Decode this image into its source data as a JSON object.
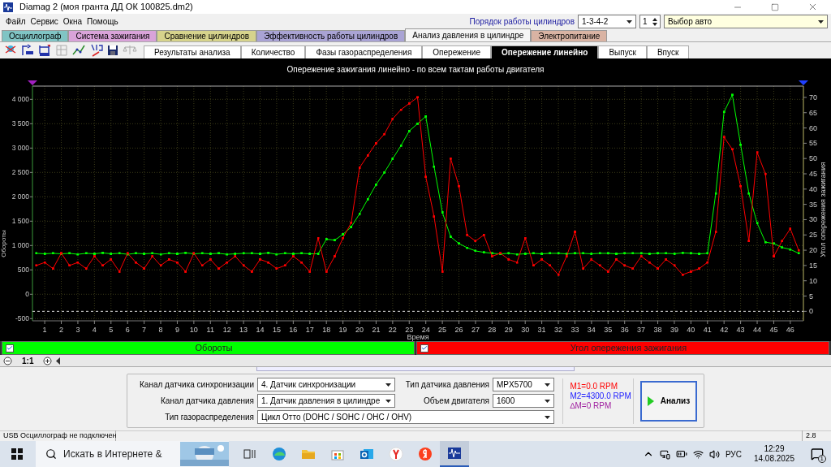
{
  "window": {
    "title": "Diamag 2 (моя гранта ДД ОК 100825.dm2)"
  },
  "menu": [
    "Файл",
    "Сервис",
    "Окна",
    "Помощь"
  ],
  "cylinder_order": {
    "label": "Порядок работы цилиндров",
    "value": "1-3-4-2"
  },
  "cylinder_spinner": {
    "value": "1"
  },
  "car_select": {
    "value": "Выбор авто"
  },
  "main_tabs": [
    {
      "label": "Осциллограф",
      "color": "#80c4c4",
      "selected": false
    },
    {
      "label": "Система зажигания",
      "color": "#d9a3d9",
      "selected": false
    },
    {
      "label": "Сравнение цилиндров",
      "color": "#d6d38c",
      "selected": false
    },
    {
      "label": "Эффективность работы цилиндров",
      "color": "#a9a3d4",
      "selected": false
    },
    {
      "label": "Анализ давления в цилиндре",
      "color": "#f5f5f5",
      "selected": true
    },
    {
      "label": "Электропитание",
      "color": "#d9b3a3",
      "selected": false
    }
  ],
  "sub_tabs": [
    {
      "label": "Результаты анализа",
      "selected": false
    },
    {
      "label": "Количество",
      "selected": false
    },
    {
      "label": "Фазы газораспределения",
      "selected": false
    },
    {
      "label": "Опережение",
      "selected": false
    },
    {
      "label": "Опережение линейно",
      "selected": true
    },
    {
      "label": "Выпуск",
      "selected": false
    },
    {
      "label": "Впуск",
      "selected": false
    }
  ],
  "chart": {
    "chart_data": {
      "type": "line",
      "title": "Опережение зажигания линейно - по всем тактам работы двигателя",
      "xlabel": "Время",
      "ylabel": "Обороты",
      "y2label": "Угол опережения зажигания",
      "x": [
        0.5,
        1,
        1.5,
        2,
        2.5,
        3,
        3.5,
        4,
        4.5,
        5,
        5.5,
        6,
        6.5,
        7,
        7.5,
        8,
        8.5,
        9,
        9.5,
        10,
        10.5,
        11,
        11.5,
        12,
        12.5,
        13,
        13.5,
        14,
        14.5,
        15,
        15.5,
        16,
        16.5,
        17,
        17.5,
        18,
        18.5,
        19,
        19.5,
        20,
        20.5,
        21,
        21.5,
        22,
        22.5,
        23,
        23.5,
        24,
        24.5,
        25,
        25.5,
        26,
        26.5,
        27,
        27.5,
        28,
        28.5,
        29,
        29.5,
        30,
        30.5,
        31,
        31.5,
        32,
        32.5,
        33,
        33.5,
        34,
        34.5,
        35,
        35.5,
        36,
        36.5,
        37,
        37.5,
        38,
        38.5,
        39,
        39.5,
        40,
        40.5,
        41,
        41.5,
        42,
        42.5,
        43,
        43.5,
        44,
        44.5,
        45,
        45.5,
        46,
        46.5
      ],
      "series": [
        {
          "name": "Обороты",
          "color": "#00ff00",
          "values": [
            840,
            830,
            840,
            830,
            840,
            820,
            840,
            830,
            850,
            830,
            840,
            820,
            840,
            830,
            840,
            820,
            840,
            830,
            850,
            830,
            840,
            830,
            840,
            820,
            830,
            840,
            840,
            830,
            850,
            820,
            840,
            830,
            840,
            830,
            830,
            1130,
            1110,
            1230,
            1380,
            1650,
            1950,
            2250,
            2500,
            2780,
            3050,
            3350,
            3500,
            3650,
            2620,
            1680,
            1180,
            1040,
            955,
            890,
            860,
            840,
            830,
            840,
            820,
            830,
            840,
            830,
            840,
            840,
            830,
            840,
            840,
            830,
            840,
            840,
            830,
            840,
            840,
            840,
            830,
            840,
            840,
            830,
            850,
            840,
            830,
            840,
            2070,
            3740,
            4090,
            3070,
            2070,
            1460,
            1070,
            1040,
            960,
            920,
            840
          ]
        },
        {
          "name": "Угол опережения зажигания",
          "color": "#ff0000",
          "axis": "y2",
          "values": [
            15,
            16,
            14,
            19,
            15,
            16,
            14,
            18,
            15,
            17,
            13,
            19,
            16,
            14,
            18,
            15,
            17,
            16,
            13,
            19,
            15,
            17,
            14,
            16,
            18,
            15,
            13,
            17,
            16,
            14,
            15,
            18,
            16,
            13,
            24,
            13,
            18,
            24,
            29,
            47,
            51,
            55,
            58,
            63,
            66,
            68,
            70,
            44,
            31,
            13,
            50,
            41,
            25,
            23,
            25,
            18,
            19,
            17,
            16,
            24,
            15,
            17,
            15,
            12,
            18,
            26,
            14,
            17,
            15,
            13,
            17,
            15,
            14,
            18,
            16,
            14,
            17,
            15,
            12,
            13,
            14,
            16,
            26,
            57,
            53,
            41,
            23,
            52,
            45,
            18,
            23,
            27,
            20
          ]
        }
      ],
      "grid": true,
      "ref_lines": [
        {
          "axis": "y2",
          "value": 0
        }
      ],
      "xlim": [
        0.26,
        46.79
      ],
      "ylim": [
        -545,
        4272
      ],
      "y2lim": [
        -3.1,
        73.7
      ],
      "xticks": [
        1,
        2,
        3,
        4,
        5,
        6,
        7,
        8,
        9,
        10,
        11,
        12,
        13,
        14,
        15,
        16,
        17,
        18,
        19,
        20,
        21,
        22,
        23,
        24,
        25,
        26,
        27,
        28,
        29,
        30,
        31,
        32,
        33,
        34,
        35,
        36,
        37,
        38,
        39,
        40,
        41,
        42,
        43,
        44,
        45,
        46
      ],
      "yticks": [
        {
          "value": -500,
          "label": "-500"
        },
        {
          "value": 0,
          "label": "0"
        },
        {
          "value": 500,
          "label": "500"
        },
        {
          "value": 1000,
          "label": "1 000"
        },
        {
          "value": 1500,
          "label": "1 500"
        },
        {
          "value": 2000,
          "label": "2 000"
        },
        {
          "value": 2500,
          "label": "2 500"
        },
        {
          "value": 3000,
          "label": "3 000"
        },
        {
          "value": 3500,
          "label": "3 500"
        },
        {
          "value": 4000,
          "label": "4 000"
        }
      ],
      "y2ticks": [
        0,
        5,
        10,
        15,
        20,
        25,
        30,
        35,
        40,
        45,
        50,
        55,
        60,
        65,
        70
      ]
    }
  },
  "legend": [
    {
      "checked": true
    },
    {
      "checked": true
    }
  ],
  "zoom_bar": {
    "scale": "1:1"
  },
  "settings": {
    "fields": [
      {
        "label": "Канал датчика синхронизации",
        "value": "4.  Датчик синхронизации"
      },
      {
        "label": "Канал датчика давления",
        "value": "1.  Датчик давления в цилиндре"
      },
      {
        "label": "Тип газораспределения",
        "value": "Цикл Отто (DOHC / SOHC / OHC / OHV)"
      },
      {
        "label": "Тип датчика давления",
        "value": "MPX5700"
      },
      {
        "label": "Объем двигателя",
        "value": "1600"
      }
    ],
    "readouts": [
      {
        "text": "M1=0.0 RPM",
        "color": "#ff0000"
      },
      {
        "text": "M2=4300.0 RPM",
        "color": "#2020ff"
      },
      {
        "text": "∆M=0 RPM",
        "color": "#a020a0"
      }
    ],
    "analyze_button": {
      "label": "Анализ"
    }
  },
  "status_bar": {
    "message": "USB Осциллограф не подключен",
    "version": "2.8"
  },
  "taskbar": {
    "search_placeholder": "Искать в Интернете &",
    "apps": [
      {
        "kind": "task-view",
        "selected": false
      },
      {
        "kind": "edge",
        "selected": false
      },
      {
        "kind": "explorer",
        "selected": false
      },
      {
        "kind": "store",
        "selected": false
      },
      {
        "kind": "outlook",
        "selected": false
      },
      {
        "kind": "yandex-browser",
        "selected": false
      },
      {
        "kind": "yandex",
        "selected": false
      },
      {
        "kind": "diamag",
        "selected": true
      }
    ],
    "language": "РУС",
    "time": "12:29",
    "date": "14.08.2025",
    "notification_count": "1"
  }
}
